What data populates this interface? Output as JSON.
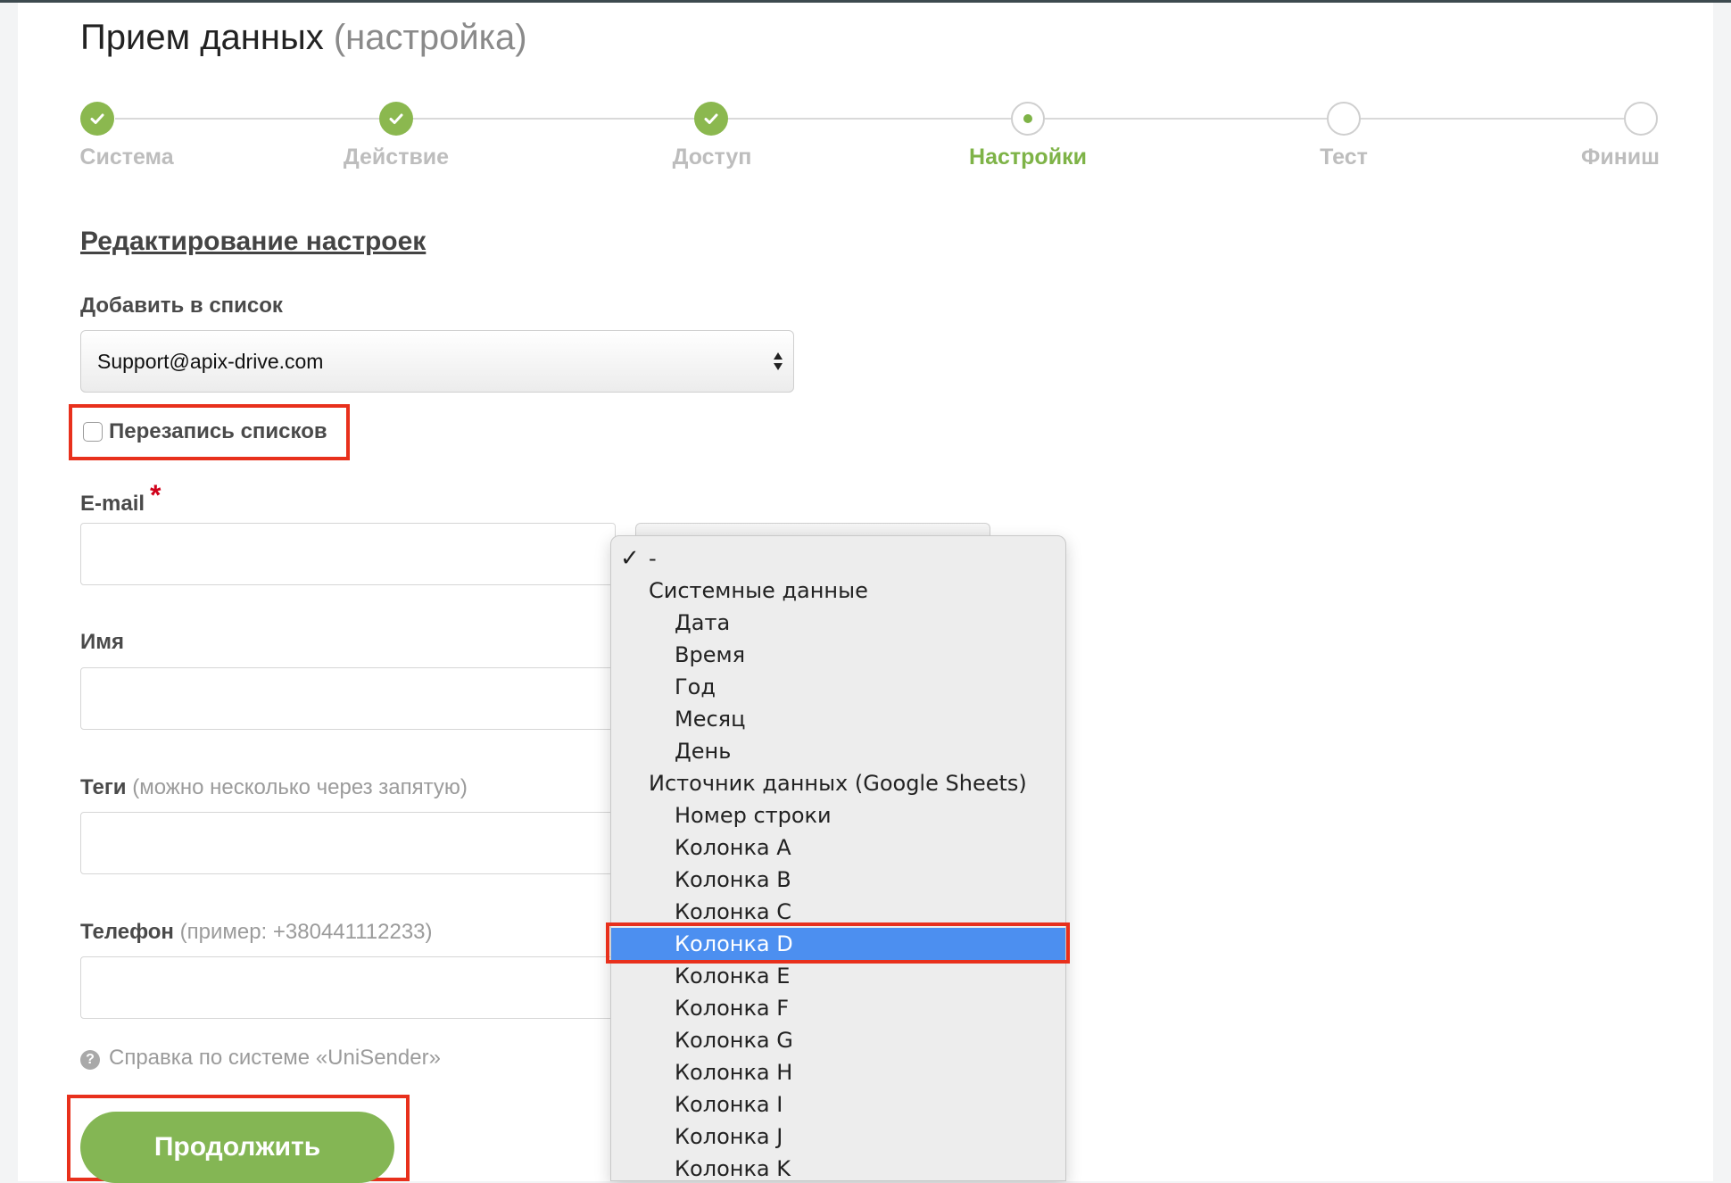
{
  "page": {
    "title_main": "Прием данных",
    "title_suffix": "(настройка)"
  },
  "steps": [
    {
      "label": "Система",
      "state": "done"
    },
    {
      "label": "Действие",
      "state": "done"
    },
    {
      "label": "Доступ",
      "state": "done"
    },
    {
      "label": "Настройки",
      "state": "current"
    },
    {
      "label": "Тест",
      "state": "todo"
    },
    {
      "label": "Финиш",
      "state": "todo"
    }
  ],
  "form": {
    "section_title": "Редактирование настроек",
    "list_label": "Добавить в список",
    "list_value": "Support@apix-drive.com",
    "overwrite_label": "Перезапись списков",
    "overwrite_checked": false,
    "email_label": "E-mail",
    "required_mark": "*",
    "name_label": "Имя",
    "tags_label": "Теги",
    "tags_hint": "(можно несколько через запятую)",
    "phone_label": "Телефон",
    "phone_hint": "(пример: +380441112233)",
    "help_icon": "?",
    "help_text": "Справка по системе «UniSender»",
    "continue_label": "Продолжить"
  },
  "dropdown": {
    "check_mark": "✓",
    "items": [
      {
        "label": "-",
        "level": 0,
        "checked": true,
        "selected": false
      },
      {
        "label": "Системные данные",
        "level": 0,
        "checked": false,
        "selected": false
      },
      {
        "label": "Дата",
        "level": 1,
        "checked": false,
        "selected": false
      },
      {
        "label": "Время",
        "level": 1,
        "checked": false,
        "selected": false
      },
      {
        "label": "Год",
        "level": 1,
        "checked": false,
        "selected": false
      },
      {
        "label": "Месяц",
        "level": 1,
        "checked": false,
        "selected": false
      },
      {
        "label": "День",
        "level": 1,
        "checked": false,
        "selected": false
      },
      {
        "label": "Источник данных (Google Sheets)",
        "level": 0,
        "checked": false,
        "selected": false
      },
      {
        "label": "Номер строки",
        "level": 1,
        "checked": false,
        "selected": false
      },
      {
        "label": "Колонка A",
        "level": 1,
        "checked": false,
        "selected": false
      },
      {
        "label": "Колонка B",
        "level": 1,
        "checked": false,
        "selected": false
      },
      {
        "label": "Колонка C",
        "level": 1,
        "checked": false,
        "selected": false
      },
      {
        "label": "Колонка D",
        "level": 1,
        "checked": false,
        "selected": true
      },
      {
        "label": "Колонка E",
        "level": 1,
        "checked": false,
        "selected": false
      },
      {
        "label": "Колонка F",
        "level": 1,
        "checked": false,
        "selected": false
      },
      {
        "label": "Колонка G",
        "level": 1,
        "checked": false,
        "selected": false
      },
      {
        "label": "Колонка H",
        "level": 1,
        "checked": false,
        "selected": false
      },
      {
        "label": "Колонка I",
        "level": 1,
        "checked": false,
        "selected": false
      },
      {
        "label": "Колонка J",
        "level": 1,
        "checked": false,
        "selected": false
      },
      {
        "label": "Колонка K",
        "level": 1,
        "checked": false,
        "selected": false
      }
    ]
  },
  "colors": {
    "accent_green": "#84b654",
    "highlight_red": "#e8301c",
    "selection_blue": "#4c8ff0"
  }
}
